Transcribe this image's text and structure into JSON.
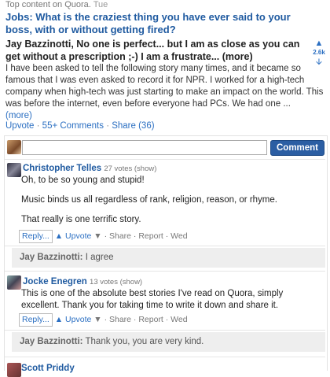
{
  "header": {
    "prefix": "Top content on Quora.",
    "date": "Tue"
  },
  "question": {
    "title": "Jobs: What is the craziest thing you have ever said to your boss, with or without getting fired?"
  },
  "answer": {
    "author_bio": "Jay Bazzinotti, No one is perfect... but I am as close as you can get without a prescription ;-) I am a frustrate...",
    "bio_more": "(more)",
    "votes": "2.6k",
    "body": "I have been asked to tell the following story many times, and it became so famous that I was even asked to record it for NPR. I worked for a high-tech company when high-tech was just starting to make an impact on the world. This was before the internet, even before everyone had PCs. We had one ...",
    "body_more": "(more)",
    "upvote": "Upvote",
    "comments": "55+ Comments",
    "share": "Share (36)"
  },
  "comment_form": {
    "button": "Comment",
    "placeholder": ""
  },
  "comments": [
    {
      "name": "Christopher Telles",
      "votes": "27 votes (show)",
      "lines": [
        "Oh, to be so young and stupid!",
        "Music binds us all regardless of rank, religion, reason, or rhyme.",
        "That really is one terrific story."
      ],
      "reply": "Reply...",
      "upvote": "▲ Upvote",
      "meta": "▼ · Share · Report · Wed",
      "sub_name": "Jay Bazzinotti:",
      "sub_text": "I agree"
    },
    {
      "name": "Jocke Enegren",
      "votes": "13 votes (show)",
      "lines": [
        "This is one of the absolute best stories I've read on Quora, simply excellent. Thank you for taking time to write it down and share it."
      ],
      "reply": "Reply...",
      "upvote": "▲ Upvote",
      "meta": "▼ · Share · Report · Wed",
      "sub_name": "Jay Bazzinotti:",
      "sub_text": "Thank you, you are very kind."
    }
  ],
  "partial_comment": {
    "name": "Scott Priddy"
  },
  "icons": {
    "up": "arrow-up-icon",
    "down": "arrow-down-icon"
  }
}
